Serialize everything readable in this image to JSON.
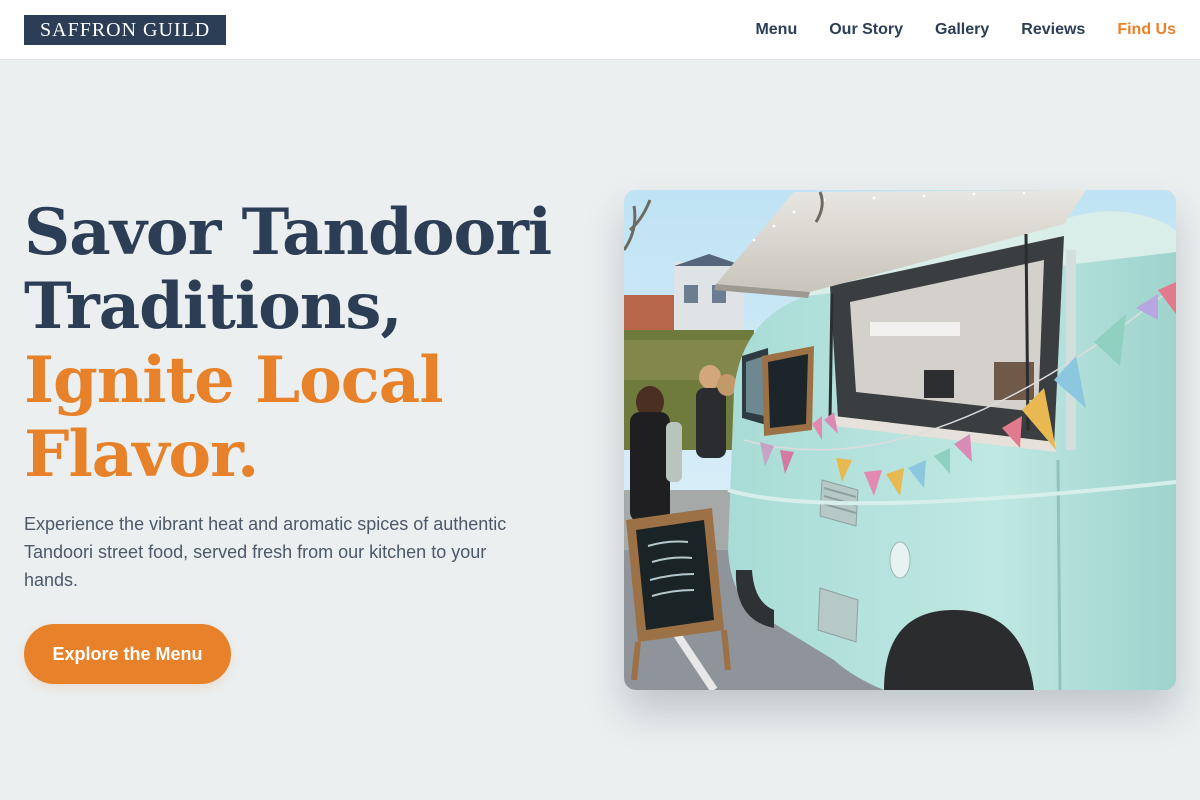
{
  "brand": {
    "name": "SAFFRON GUILD"
  },
  "nav": {
    "items": [
      {
        "label": "Menu",
        "active": false
      },
      {
        "label": "Our Story",
        "active": false
      },
      {
        "label": "Gallery",
        "active": false
      },
      {
        "label": "Reviews",
        "active": false
      },
      {
        "label": "Find Us",
        "active": true
      }
    ]
  },
  "hero": {
    "headline_line1": "Savor Tandoori",
    "headline_line2": "Traditions,",
    "headline_line3": "Ignite Local",
    "headline_line4": "Flavor.",
    "subtitle": "Experience the vibrant heat and aromatic spices of authentic Tandoori street food, served fresh from our kitchen to your hands.",
    "cta_label": "Explore the Menu",
    "image": "teal-food-truck-photo"
  },
  "colors": {
    "navy": "#2c3e55",
    "accent": "#e8822a",
    "background": "#ebeff0"
  }
}
